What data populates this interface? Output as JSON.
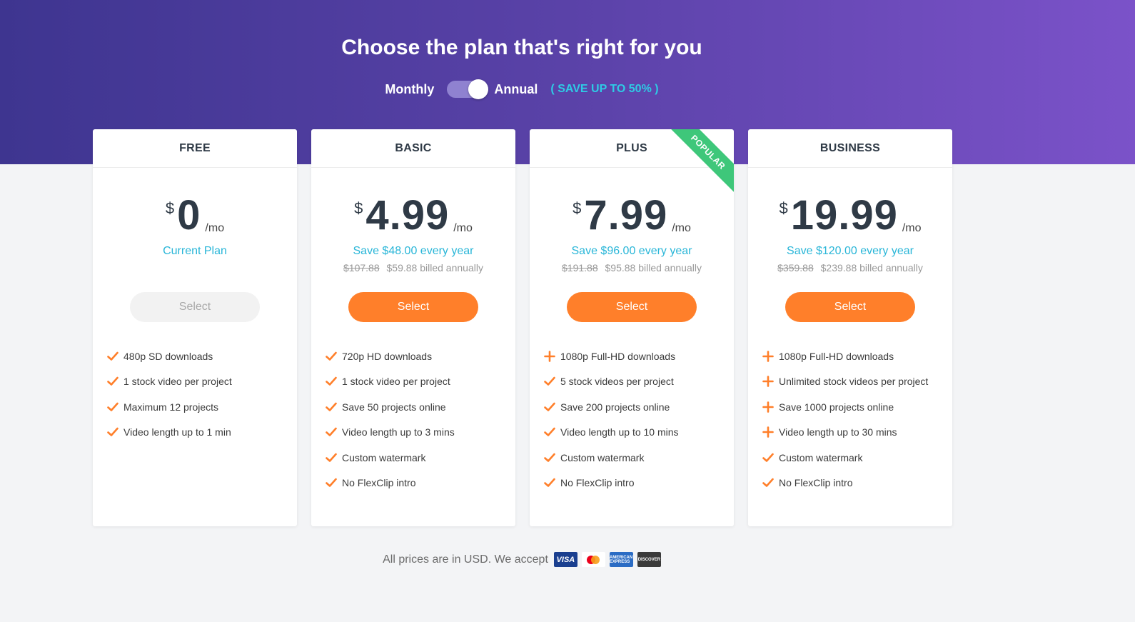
{
  "header": {
    "title": "Choose the plan that's right for you",
    "monthly_label": "Monthly",
    "annual_label": "Annual",
    "save_note": "( SAVE UP TO 50% )",
    "billing_annual_selected": true
  },
  "currency_symbol": "$",
  "per_label": "/mo",
  "plans": [
    {
      "name": "FREE",
      "price": "0",
      "save_text": "Current Plan",
      "original_price": "",
      "billed_text": "",
      "button_label": "Select",
      "button_enabled": false,
      "features": [
        {
          "text": "480p SD downloads",
          "icon": "check-icon"
        },
        {
          "text": "1 stock video per project",
          "icon": "check-icon"
        },
        {
          "text": "Maximum 12 projects",
          "icon": "check-icon"
        },
        {
          "text": "Video length up to 1 min",
          "icon": "check-icon"
        }
      ]
    },
    {
      "name": "BASIC",
      "price": "4.99",
      "save_text": "Save $48.00 every year",
      "original_price": "$107.88",
      "billed_text": "$59.88 billed annually",
      "button_label": "Select",
      "button_enabled": true,
      "features": [
        {
          "text": "720p HD downloads",
          "icon": "check-icon"
        },
        {
          "text": "1 stock video per project",
          "icon": "check-icon"
        },
        {
          "text": "Save 50 projects online",
          "icon": "check-icon"
        },
        {
          "text": "Video length up to 3 mins",
          "icon": "check-icon"
        },
        {
          "text": "Custom watermark",
          "icon": "check-icon"
        },
        {
          "text": "No FlexClip intro",
          "icon": "check-icon"
        }
      ]
    },
    {
      "name": "PLUS",
      "badge": "POPULAR",
      "price": "7.99",
      "save_text": "Save $96.00 every year",
      "original_price": "$191.88",
      "billed_text": "$95.88 billed annually",
      "button_label": "Select",
      "button_enabled": true,
      "features": [
        {
          "text": "1080p Full-HD downloads",
          "icon": "plus-icon"
        },
        {
          "text": "5 stock videos per project",
          "icon": "check-icon"
        },
        {
          "text": "Save 200 projects online",
          "icon": "check-icon"
        },
        {
          "text": "Video length up to 10 mins",
          "icon": "check-icon"
        },
        {
          "text": "Custom watermark",
          "icon": "check-icon"
        },
        {
          "text": "No FlexClip intro",
          "icon": "check-icon"
        }
      ]
    },
    {
      "name": "BUSINESS",
      "price": "19.99",
      "save_text": "Save $120.00 every year",
      "original_price": "$359.88",
      "billed_text": "$239.88 billed annually",
      "button_label": "Select",
      "button_enabled": true,
      "features": [
        {
          "text": "1080p Full-HD downloads",
          "icon": "plus-icon"
        },
        {
          "text": "Unlimited stock videos per project",
          "icon": "plus-icon"
        },
        {
          "text": "Save 1000 projects online",
          "icon": "plus-icon"
        },
        {
          "text": "Video length up to 30 mins",
          "icon": "plus-icon"
        },
        {
          "text": "Custom watermark",
          "icon": "check-icon"
        },
        {
          "text": "No FlexClip intro",
          "icon": "check-icon"
        }
      ]
    }
  ],
  "footer": {
    "text": "All prices are in USD. We accept",
    "payment_icons": [
      "visa-icon",
      "mastercard-icon",
      "amex-icon",
      "discover-icon"
    ],
    "visa_label": "VISA",
    "amex_label": "AMERICAN EXPRESS",
    "discover_label": "DISCOVER"
  },
  "colors": {
    "accent_orange": "#ff7f2a",
    "accent_teal": "#29b6d8",
    "badge_green": "#3ec77a",
    "hero_start": "#3e3590",
    "hero_end": "#7b52c9"
  }
}
